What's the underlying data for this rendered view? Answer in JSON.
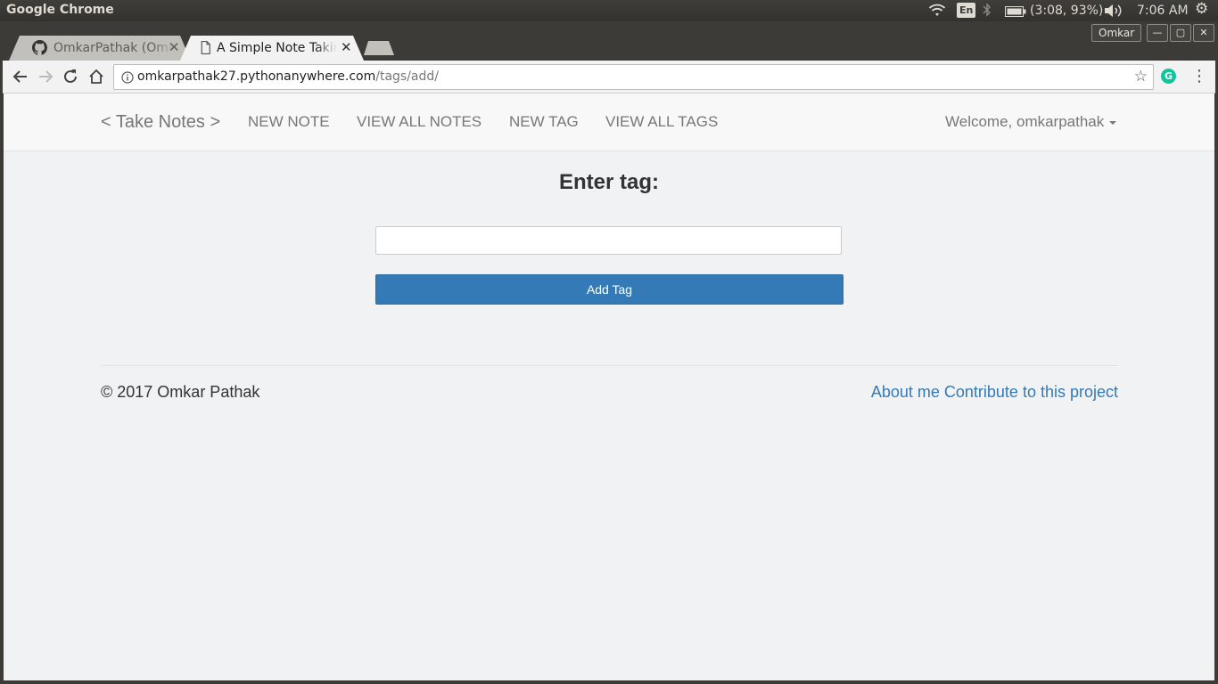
{
  "os": {
    "app_title": "Google Chrome",
    "language": "En",
    "battery": "(3:08, 93%)",
    "time": "7:06 AM"
  },
  "tabs": [
    {
      "title": "OmkarPathak (Omkar Pathak)",
      "favicon": "github-icon",
      "active": false
    },
    {
      "title": "A Simple Note Taking App",
      "favicon": "document-icon",
      "active": true
    }
  ],
  "window": {
    "user": "Omkar"
  },
  "address_bar": {
    "host": "omkarpathak27.pythonanywhere.com",
    "path": "/tags/add/"
  },
  "site": {
    "brand": "< Take Notes >",
    "nav": [
      "NEW NOTE",
      "VIEW ALL NOTES",
      "NEW TAG",
      "VIEW ALL TAGS"
    ],
    "welcome": "Welcome, omkarpathak"
  },
  "form": {
    "heading": "Enter tag:",
    "input_value": "",
    "submit_label": "Add Tag"
  },
  "footer": {
    "copyright": "© 2017 Omkar Pathak",
    "links": [
      "About me",
      "Contribute to this project"
    ]
  },
  "colors": {
    "primary": "#337ab7",
    "page_bg": "#f1f2f4",
    "navbar_bg": "#f8f8f8",
    "os_panel": "#3c3b37"
  }
}
